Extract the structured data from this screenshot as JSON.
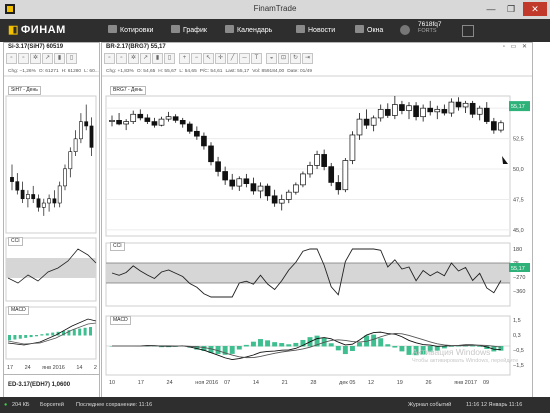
{
  "window": {
    "title": "FinamTrade"
  },
  "toolbar": {
    "logo": "ФИНАМ",
    "buttons": [
      {
        "label": "Котировки"
      },
      {
        "label": "График"
      },
      {
        "label": "Календарь"
      },
      {
        "label": "Новости"
      },
      {
        "label": "Окна"
      }
    ],
    "account_id": "7618fq7",
    "account_sub": "FORTS"
  },
  "left_panel": {
    "title": "Si-3.17(SiH7) 60519",
    "stats": [
      "Chg: −1,26%",
      "O: 61271",
      "H: 61280",
      "L: 60..."
    ],
    "chart_tag": "SiH7 - День",
    "cci_tag": "CCI",
    "macd_tag": "MACD",
    "dates": [
      "17",
      "24",
      "янв 2016",
      "14",
      "2"
    ],
    "footer_title": "ED-3.17(EDH7) 1,0600"
  },
  "main_panel": {
    "title": "BR-2.17(BRG7) 55,17",
    "stats": [
      "Chg: +1,83%",
      "O: 54,65",
      "H: 55,67",
      "L: 54,65",
      "P/C: 54,61",
      "Last: 55,17",
      "Vol: 859184,00",
      "Date: 01/49"
    ],
    "chart_tag": "BRG7 - День",
    "cci_tag": "CCI",
    "macd_tag": "MACD",
    "price_label": "55,17",
    "price_axis": [
      "55,0",
      "52,5",
      "50,0",
      "47,5",
      "45,0"
    ],
    "cci_label": "55,17",
    "cci_axis": [
      "180",
      "75",
      "−270",
      "−360"
    ],
    "macd_axis": [
      "1,5",
      "0,3",
      "−0,5",
      "−1,5"
    ],
    "dates": [
      "10",
      "17",
      "24",
      "ноя 2016",
      "07",
      "14",
      "21",
      "28",
      "дек 05",
      "12",
      "19",
      "26",
      "янв 2017",
      "09"
    ]
  },
  "status": {
    "speed": "204 КБ",
    "mode": "Борсетей",
    "saved": "Последнее сохранение: 11:16",
    "journal": "Журнал событий",
    "datetime": "11:16 12 Январь 11:16"
  },
  "watermark": {
    "line1": "Активация Windows",
    "line2": "Чтобы активировать Windows, перейдите"
  },
  "chart_data": {
    "type": "candlestick",
    "title": "BR-2.17(BRG7) 55,17",
    "y_range": [
      44.5,
      56.0
    ],
    "candles": [
      [
        53.9,
        54.4,
        53.5,
        54.0
      ],
      [
        54.0,
        54.6,
        53.6,
        53.7
      ],
      [
        53.7,
        54.1,
        53.2,
        53.9
      ],
      [
        53.9,
        54.8,
        53.7,
        54.5
      ],
      [
        54.5,
        54.9,
        54.0,
        54.2
      ],
      [
        54.2,
        54.5,
        53.7,
        53.9
      ],
      [
        53.9,
        54.2,
        53.4,
        53.6
      ],
      [
        53.6,
        54.3,
        53.5,
        54.1
      ],
      [
        54.1,
        54.7,
        53.9,
        54.3
      ],
      [
        54.3,
        54.5,
        53.8,
        54.0
      ],
      [
        54.0,
        54.2,
        53.4,
        53.7
      ],
      [
        53.7,
        53.9,
        52.9,
        53.1
      ],
      [
        53.1,
        53.5,
        52.4,
        52.7
      ],
      [
        52.7,
        53.0,
        51.6,
        51.9
      ],
      [
        51.9,
        52.2,
        50.3,
        50.6
      ],
      [
        50.6,
        51.0,
        49.4,
        49.8
      ],
      [
        49.8,
        50.2,
        48.7,
        49.1
      ],
      [
        49.1,
        49.6,
        48.3,
        48.6
      ],
      [
        48.6,
        49.4,
        48.2,
        49.2
      ],
      [
        49.2,
        49.6,
        48.5,
        48.8
      ],
      [
        48.8,
        49.3,
        47.9,
        48.2
      ],
      [
        48.2,
        48.9,
        47.6,
        48.6
      ],
      [
        48.6,
        48.8,
        47.4,
        47.8
      ],
      [
        47.8,
        48.3,
        46.9,
        47.2
      ],
      [
        47.2,
        47.9,
        46.6,
        47.5
      ],
      [
        47.5,
        48.3,
        47.2,
        48.1
      ],
      [
        48.1,
        48.9,
        47.9,
        48.7
      ],
      [
        48.7,
        49.8,
        48.5,
        49.6
      ],
      [
        49.6,
        50.6,
        49.3,
        50.3
      ],
      [
        50.3,
        51.5,
        50.0,
        51.2
      ],
      [
        51.2,
        51.6,
        49.9,
        50.2
      ],
      [
        50.2,
        50.5,
        48.6,
        48.9
      ],
      [
        48.9,
        49.5,
        47.9,
        48.3
      ],
      [
        48.3,
        50.9,
        48.1,
        50.7
      ],
      [
        50.7,
        53.1,
        50.4,
        52.8
      ],
      [
        52.8,
        54.6,
        52.4,
        54.1
      ],
      [
        54.1,
        54.9,
        53.3,
        53.6
      ],
      [
        53.6,
        54.4,
        53.1,
        54.2
      ],
      [
        54.2,
        55.3,
        53.9,
        54.9
      ],
      [
        54.9,
        55.4,
        54.2,
        54.4
      ],
      [
        54.4,
        56.0,
        54.1,
        55.3
      ],
      [
        55.3,
        55.6,
        54.5,
        54.8
      ],
      [
        54.8,
        55.5,
        54.1,
        55.2
      ],
      [
        55.2,
        55.5,
        54.0,
        54.3
      ],
      [
        54.3,
        55.3,
        53.9,
        55.0
      ],
      [
        55.0,
        55.6,
        54.4,
        54.7
      ],
      [
        54.7,
        55.2,
        54.1,
        54.9
      ],
      [
        54.9,
        55.3,
        54.4,
        54.6
      ],
      [
        54.6,
        55.8,
        54.3,
        55.5
      ],
      [
        55.5,
        55.9,
        54.8,
        55.1
      ],
      [
        55.1,
        55.6,
        54.6,
        55.4
      ],
      [
        55.4,
        55.6,
        54.2,
        54.5
      ],
      [
        54.5,
        55.2,
        54.0,
        55.0
      ],
      [
        55.0,
        55.5,
        53.7,
        53.9
      ],
      [
        53.9,
        54.2,
        52.9,
        53.2
      ],
      [
        53.2,
        54.0,
        53.0,
        53.8
      ]
    ]
  }
}
